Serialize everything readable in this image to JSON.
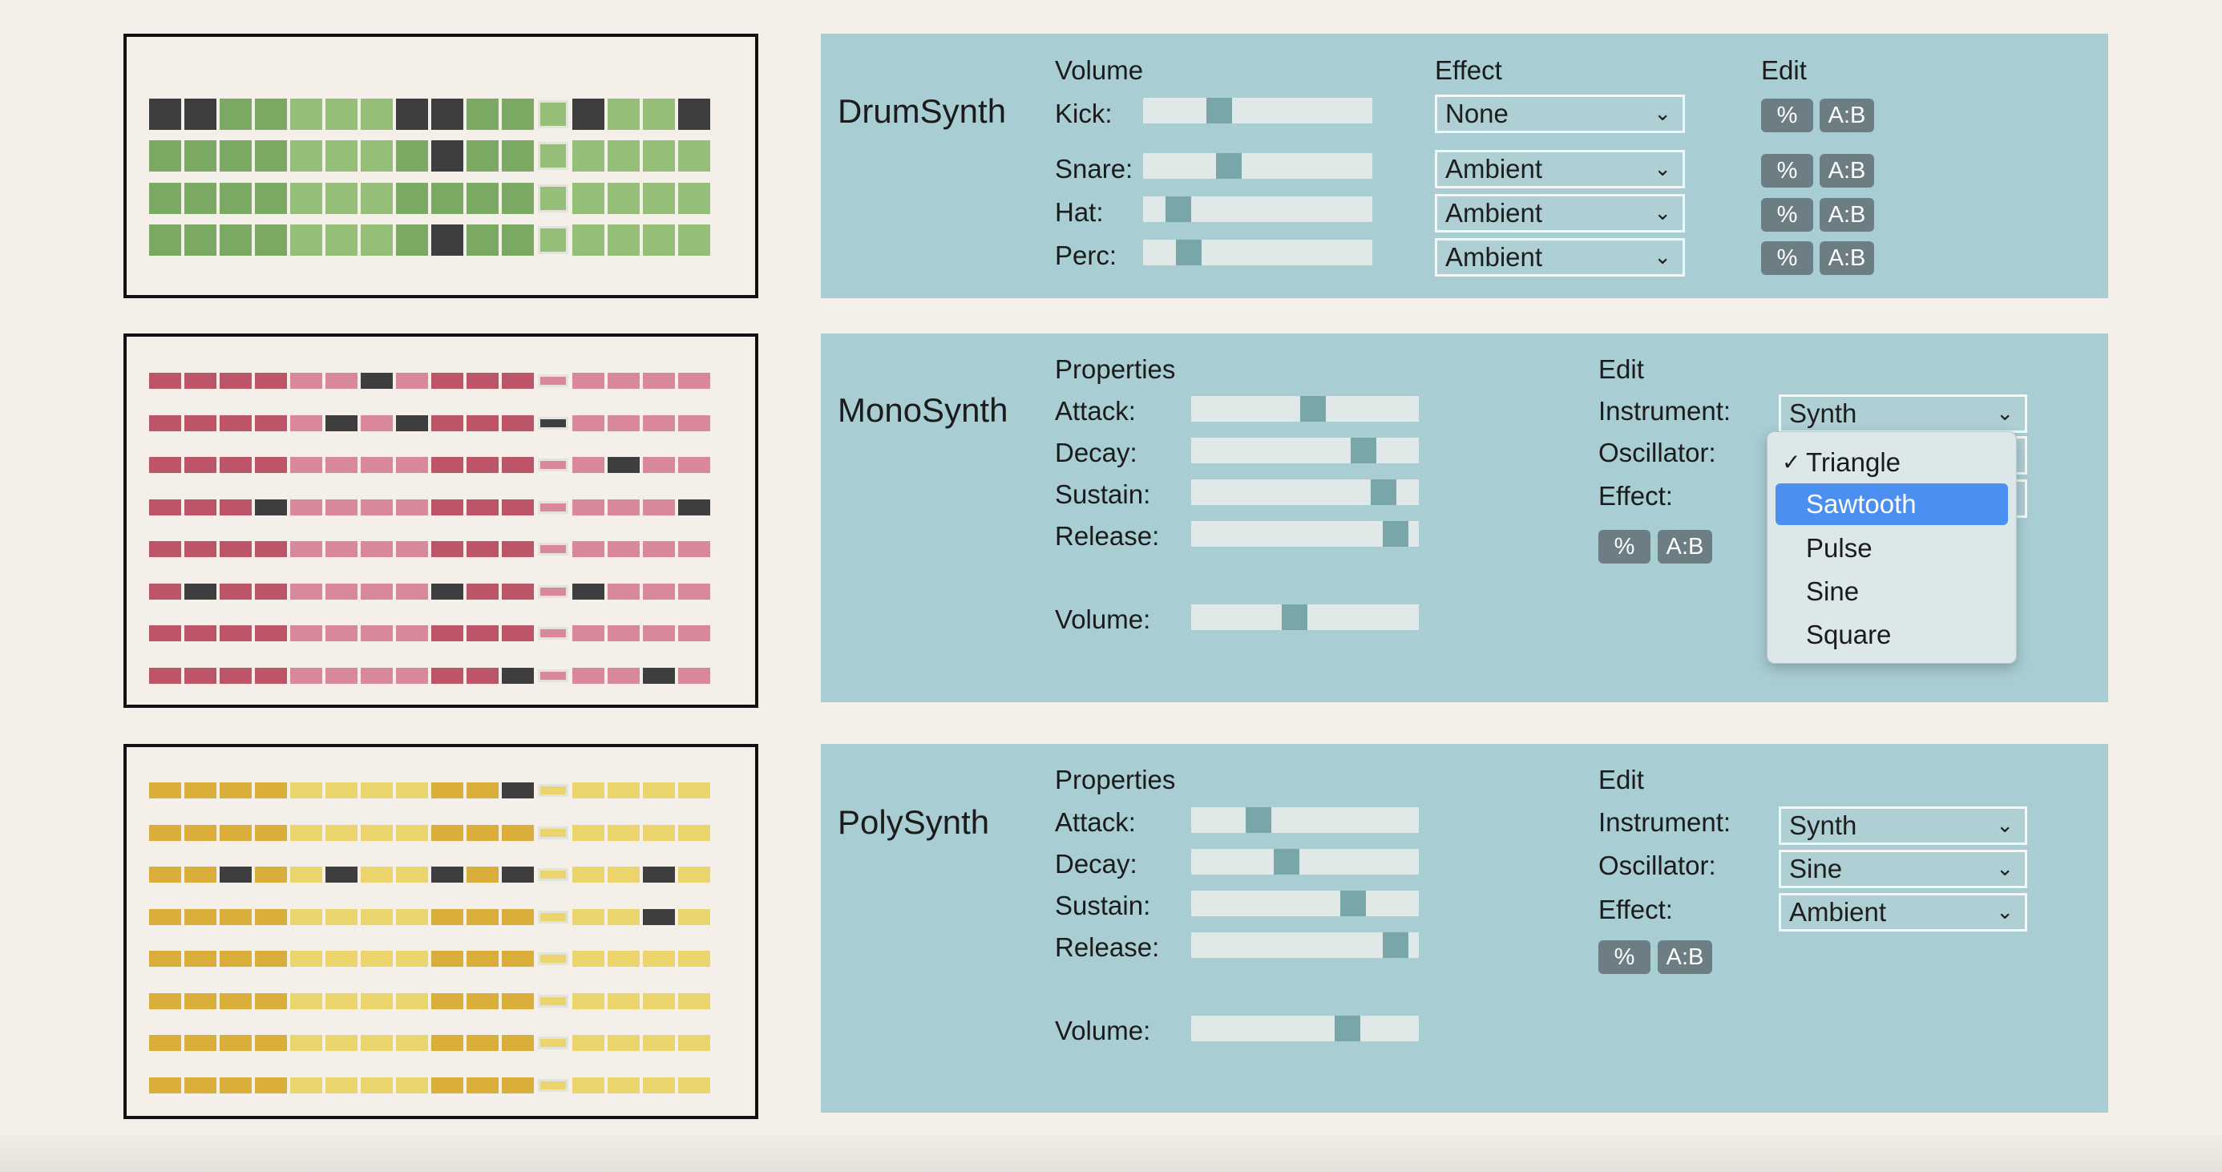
{
  "drum": {
    "title": "DrumSynth",
    "headers": {
      "volume": "Volume",
      "effect": "Effect",
      "edit": "Edit"
    },
    "rows": [
      {
        "label": "Kick:",
        "volume": 0.31,
        "effect": "None"
      },
      {
        "label": "Snare:",
        "volume": 0.36,
        "effect": "Ambient"
      },
      {
        "label": "Hat:",
        "volume": 0.11,
        "effect": "Ambient"
      },
      {
        "label": "Perc:",
        "volume": 0.16,
        "effect": "Ambient"
      }
    ],
    "grid": {
      "colors": {
        "a": "#7ba862",
        "b": "#95bf78",
        "x": "#3e3e3e"
      },
      "pattern": [
        "xxaabbbxxaabxbbx",
        "aaaabbbaxaabbbbb",
        "aaaabbbaaaabbbbb",
        "aaaabbbaxaabbbbb"
      ]
    }
  },
  "mono": {
    "title": "MonoSynth",
    "properties_header": "Properties",
    "edit_header": "Edit",
    "props": [
      {
        "label": "Attack:",
        "value": 0.54
      },
      {
        "label": "Decay:",
        "value": 0.79
      },
      {
        "label": "Sustain:",
        "value": 0.89
      },
      {
        "label": "Release:",
        "value": 0.95
      }
    ],
    "volume": {
      "label": "Volume:",
      "value": 0.45
    },
    "edit": {
      "instrument": {
        "label": "Instrument:",
        "value": "Synth"
      },
      "oscillator": {
        "label": "Oscillator:"
      },
      "effect": {
        "label": "Effect:"
      }
    },
    "oscillator_menu": {
      "checked": "Triangle",
      "highlighted": "Sawtooth",
      "options": [
        "Triangle",
        "Sawtooth",
        "Pulse",
        "Sine",
        "Square"
      ]
    },
    "grid": {
      "colors": {
        "a": "#bd5569",
        "b": "#d9879a",
        "x": "#3e3e3e"
      },
      "pattern": [
        "aaaabbxbaaabbbbb",
        "aaaabxbxaaaxbbbb",
        "aaaabbbbaaabbxbb",
        "aaaxbbbbaaabbbbx",
        "aaaabbbbaaabbbbb",
        "axaabbbbxaabxbbb",
        "aaaabbbbaaabbbbb",
        "aaaabbbbaaxbbbxb"
      ]
    }
  },
  "poly": {
    "title": "PolySynth",
    "properties_header": "Properties",
    "edit_header": "Edit",
    "props": [
      {
        "label": "Attack:",
        "value": 0.27
      },
      {
        "label": "Decay:",
        "value": 0.41
      },
      {
        "label": "Sustain:",
        "value": 0.74
      },
      {
        "label": "Release:",
        "value": 0.95
      }
    ],
    "volume": {
      "label": "Volume:",
      "value": 0.71
    },
    "edit": {
      "instrument": {
        "label": "Instrument:",
        "value": "Synth"
      },
      "oscillator": {
        "label": "Oscillator:",
        "value": "Sine"
      },
      "effect": {
        "label": "Effect:",
        "value": "Ambient"
      }
    },
    "grid": {
      "colors": {
        "a": "#d9ae3b",
        "b": "#ecd46d",
        "x": "#3e3e3e"
      },
      "pattern": [
        "aaaabbbbaaxbbbbb",
        "aaaabbbbaaabbbbb",
        "aaxabxbbxaxbbbxb",
        "aaaabbbbaaabbbxb",
        "aaaabbbbaaabbbbb",
        "aaaabbbbaaabbbbb",
        "aaaabbbbaaabbbbb",
        "aaaabbbbaaabbbbb"
      ]
    }
  },
  "buttons": {
    "percent": "%",
    "ab": "A:B"
  },
  "icons": {
    "dropdown": "chevron-down-icon",
    "check": "checkmark-icon"
  }
}
